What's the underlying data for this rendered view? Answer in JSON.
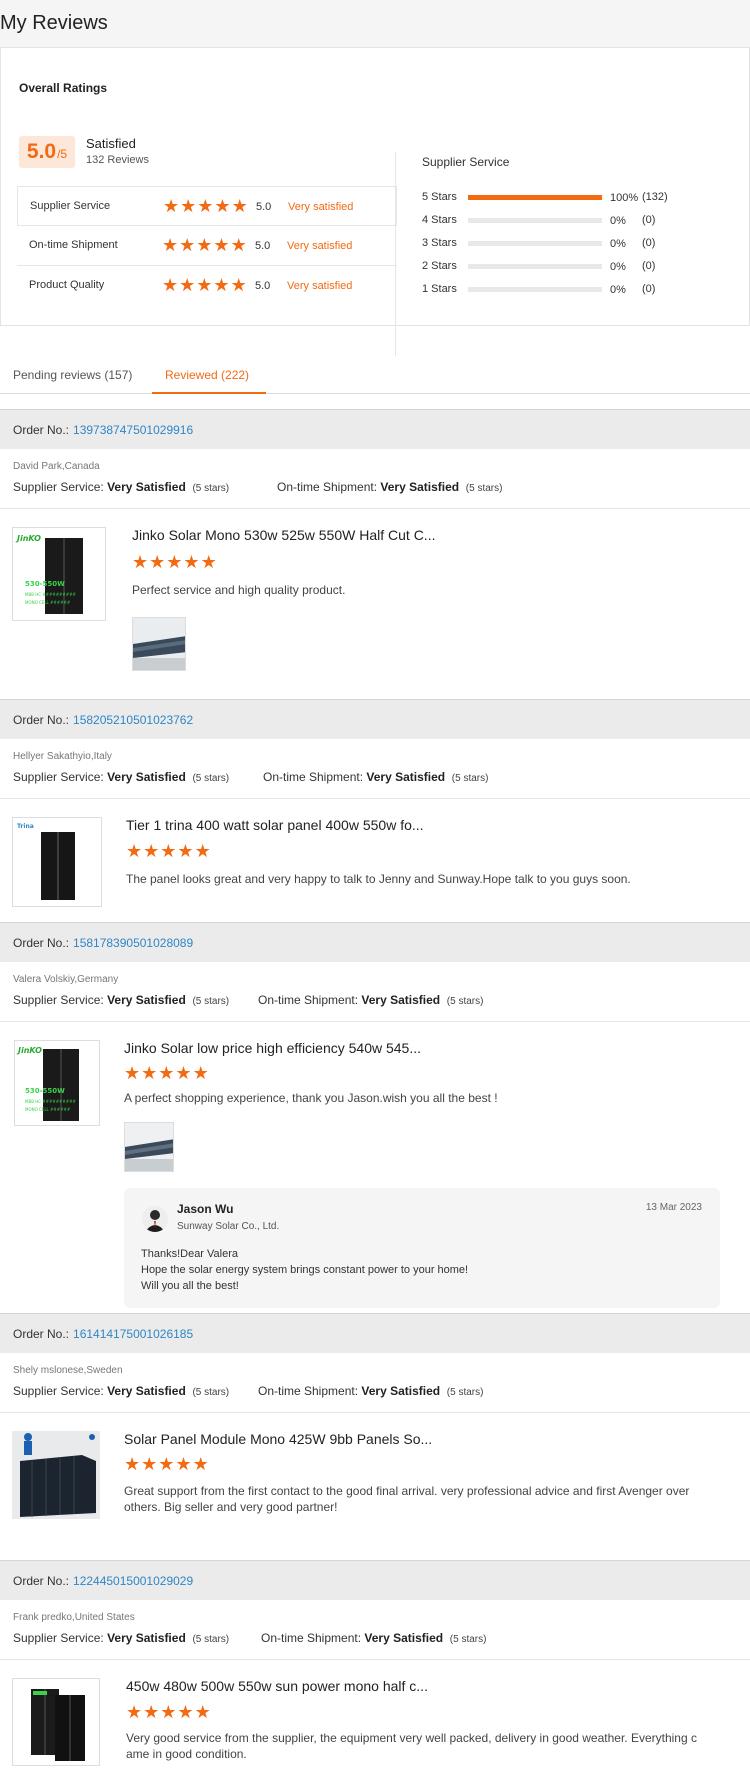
{
  "page": {
    "title": "My Reviews"
  },
  "ratings": {
    "title": "Overall Ratings",
    "score": "5.0",
    "score_suffix": "/5",
    "summary": "Satisfied",
    "review_count": "132 Reviews",
    "rows": [
      {
        "label": "Supplier Service",
        "score": "5.0",
        "text": "Very satisfied",
        "stars": 5
      },
      {
        "label": "On-time Shipment",
        "score": "5.0",
        "text": "Very satisfied",
        "stars": 5
      },
      {
        "label": "Product Quality",
        "score": "5.0",
        "text": "Very satisfied",
        "stars": 5
      }
    ],
    "distribution": {
      "title": "Supplier Service",
      "rows": [
        {
          "label": "5 Stars",
          "pct": "100%",
          "count": "(132)",
          "fraction": 1.0
        },
        {
          "label": "4 Stars",
          "pct": "0%",
          "count": "(0)",
          "fraction": 0
        },
        {
          "label": "3 Stars",
          "pct": "0%",
          "count": "(0)",
          "fraction": 0
        },
        {
          "label": "2 Stars",
          "pct": "0%",
          "count": "(0)",
          "fraction": 0
        },
        {
          "label": "1 Stars",
          "pct": "0%",
          "count": "(0)",
          "fraction": 0
        }
      ]
    }
  },
  "tabs": [
    {
      "label": "Pending reviews (157)",
      "active": false
    },
    {
      "label": "Reviewed (222)",
      "active": true
    }
  ],
  "labels": {
    "order_no": "Order No.:",
    "supplier_service": "Supplier Service:",
    "ontime_shipment": "On-time Shipment:",
    "very_satisfied": "Very Satisfied",
    "five_stars": "(5 stars)"
  },
  "orders": [
    {
      "number": "1397387475010299​16",
      "buyer": "David Park,Canada",
      "product": "Jinko Solar Mono 530w 525w 550W Half Cut C...",
      "review": "Perfect service and high quality product.",
      "has_photo": true,
      "thumb": "jinko"
    },
    {
      "number": "158205210501023762",
      "buyer": "Hellyer Sakathyio,Italy",
      "product": "Tier 1 trina 400 watt solar panel 400w 550w fo...",
      "review": "The panel looks great and very happy to talk to Jenny and Sunway.Hope talk to you guys soon.",
      "has_photo": false,
      "thumb": "trina"
    },
    {
      "number": "158178390501028089",
      "buyer": "Valera Volskiy,Germany",
      "product": "Jinko Solar low price high efficiency 540w 545...",
      "review": "A perfect shopping experience, thank you Jason.wish you all the best !",
      "has_photo": true,
      "thumb": "jinko",
      "reply": {
        "name": "Jason Wu",
        "company": "Sunway Solar Co., Ltd.",
        "date": "13 Mar 2023",
        "line1": "Thanks!Dear Valera",
        "line2": "Hope the solar energy system brings constant power to your home!",
        "line3": "Will you all the best!"
      }
    },
    {
      "number": "161414175001026185",
      "buyer": "Shely mslonese,Sweden",
      "product": "Solar Panel Module Mono 425W 9bb Panels So...",
      "review_line1": "Great support from the first contact to the good final arrival. very professional advice and first Avenger over",
      "review_line2": "others. Big seller and very good partner!",
      "has_photo": false,
      "thumb": "stack"
    },
    {
      "number": "122445015001029029",
      "buyer": "Frank predko,United States",
      "product": "450w 480w 500w 550w sun power mono half c...",
      "review_line1": "Very good service from the supplier, the equipment very well packed, delivery in good weather. Everything c",
      "review_line2": "ame in good condition.",
      "has_photo": false,
      "thumb": "dual"
    }
  ],
  "colors": {
    "accent": "#f26a12",
    "link": "#2f86c6"
  }
}
